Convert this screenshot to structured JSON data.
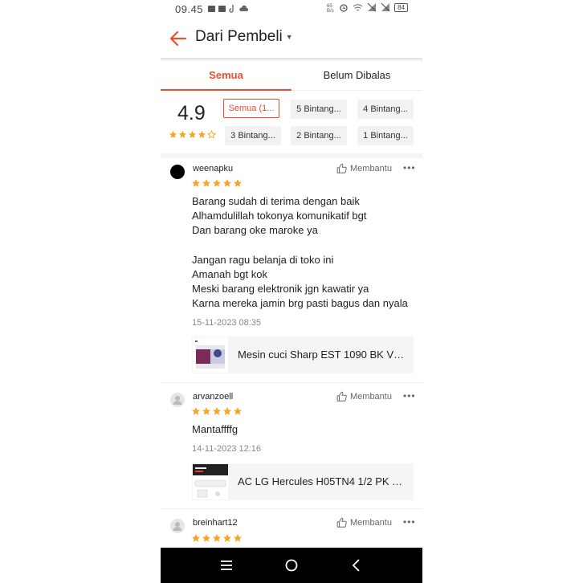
{
  "status_bar": {
    "time": "09.45",
    "battery": "84",
    "net_speed": "65\nB/s"
  },
  "header": {
    "title": "Dari Pembeli",
    "back_icon": "arrow-left-icon",
    "caret_icon": "caret-down-icon"
  },
  "tabs": [
    {
      "label": "Semua",
      "active": true
    },
    {
      "label": "Belum Dibalas",
      "active": false
    }
  ],
  "summary": {
    "score": "4.9",
    "stars": 4.5,
    "filters": [
      {
        "label": "Semua (1...",
        "active": true
      },
      {
        "label": "5 Bintang...",
        "active": false
      },
      {
        "label": "4 Bintang...",
        "active": false
      },
      {
        "label": "3 Bintang...",
        "active": false
      },
      {
        "label": "2 Bintang...",
        "active": false
      },
      {
        "label": "1 Bintang...",
        "active": false
      }
    ]
  },
  "reviews": [
    {
      "username": "weenapku",
      "avatar": "black",
      "stars": 5,
      "helpful_label": "Membantu",
      "text": "Barang sudah di terima dengan baik\nAlhamdulillah tokonya komunikatif bgt\nDan barang oke maroke ya\n\nJangan ragu belanja di toko ini\nAmanah bgt kok\nMeski barang elektronik jgn kawatir ya\nKarna mereka jamin brg pasti bagus dan nyala",
      "date": "15-11-2023 08:35",
      "product": "Mesin cuci Sharp EST 1090 BK VK..."
    },
    {
      "username": "arvanzoell",
      "avatar": "grey",
      "stars": 5,
      "helpful_label": "Membantu",
      "text": "Mantaffffg",
      "date": "14-11-2023 12:16",
      "product": "AC LG Hercules H05TN4 1/2 PK TU..."
    },
    {
      "username": "breinhart12",
      "avatar": "grey",
      "stars": 5,
      "helpful_label": "Membantu"
    }
  ],
  "colors": {
    "accent": "#ee4d2d",
    "star": "#f5a623"
  },
  "nav_icons": [
    "menu-icon",
    "home-circle-icon",
    "back-chevron-icon"
  ]
}
